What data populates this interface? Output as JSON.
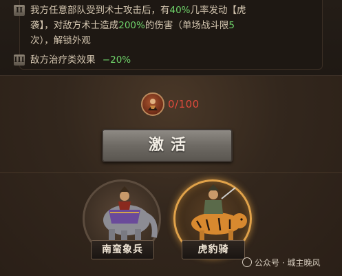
{
  "skills": {
    "row2": {
      "numeral": "II",
      "line1_a": "我方任意部队受到术士攻击后，有",
      "line1_pct": "40%",
      "line1_b": "几率发动【虎",
      "line2_a": "袭】，对敌方术士造成",
      "line2_pct": "200%",
      "line2_b": "的伤害（单场战斗限",
      "line2_n": "5",
      "line3": "次），解锁外观"
    },
    "row3": {
      "numeral": "III",
      "text": "敌方治疗类效果",
      "value": "−20%"
    }
  },
  "progress": {
    "text": "0/100"
  },
  "activate": {
    "label": "激活"
  },
  "units": [
    {
      "name": "南蛮象兵"
    },
    {
      "name": "虎豹骑"
    }
  ],
  "watermark": {
    "text": "公众号 · 城主晚风"
  },
  "colors": {
    "highlight": "#6fd36a",
    "progress": "#e04a3c",
    "selected_glow": "#e0a24a"
  }
}
